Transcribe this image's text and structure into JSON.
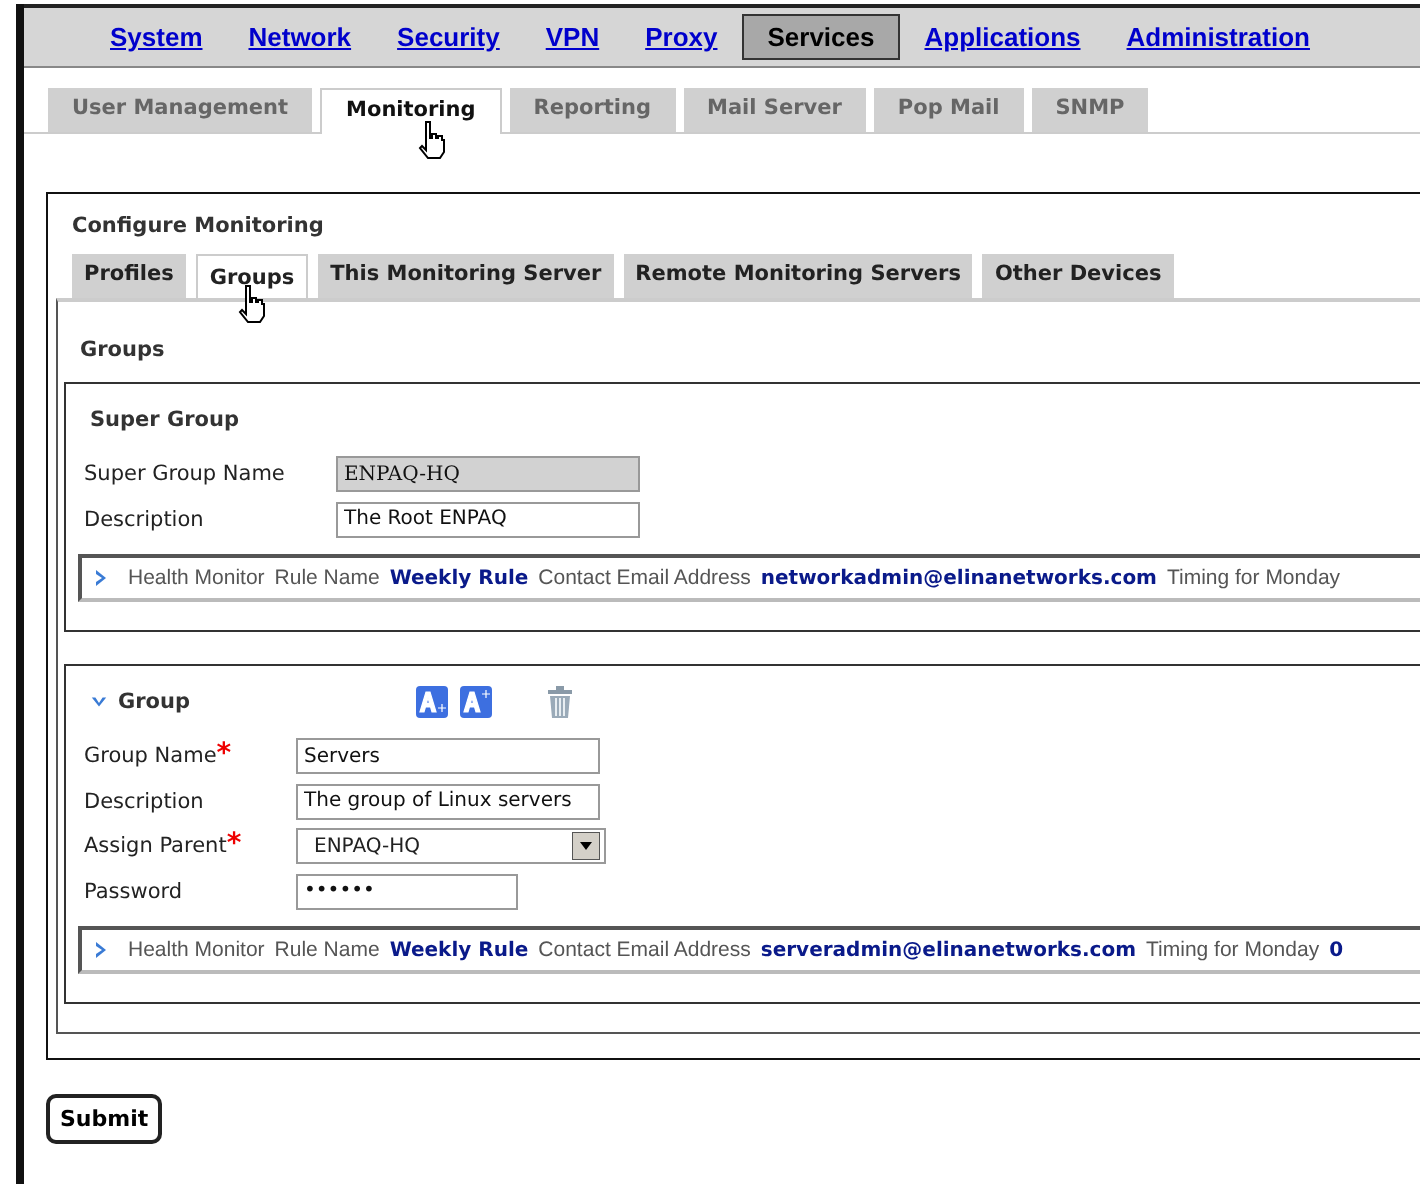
{
  "nav": [
    {
      "label": "System",
      "selected": false
    },
    {
      "label": "Network",
      "selected": false
    },
    {
      "label": "Security",
      "selected": false
    },
    {
      "label": "VPN",
      "selected": false
    },
    {
      "label": "Proxy",
      "selected": false
    },
    {
      "label": "Services",
      "selected": true
    },
    {
      "label": "Applications",
      "selected": false
    },
    {
      "label": "Administration",
      "selected": false
    }
  ],
  "subtabs": [
    {
      "label": "User Management",
      "selected": false
    },
    {
      "label": "Monitoring",
      "selected": true
    },
    {
      "label": "Reporting",
      "selected": false
    },
    {
      "label": "Mail Server",
      "selected": false
    },
    {
      "label": "Pop Mail",
      "selected": false
    },
    {
      "label": "SNMP",
      "selected": false
    }
  ],
  "section_title": "Configure Monitoring",
  "tabs": [
    {
      "label": "Profiles",
      "selected": false
    },
    {
      "label": "Groups",
      "selected": true
    },
    {
      "label": "This Monitoring Server",
      "selected": false
    },
    {
      "label": "Remote Monitoring Servers",
      "selected": false
    },
    {
      "label": "Other Devices",
      "selected": false
    }
  ],
  "panel_title": "Groups",
  "super_group": {
    "title": "Super Group",
    "fields": [
      {
        "label": "Super Group Name",
        "value": "ENPAQ-HQ",
        "kind": "readonly"
      },
      {
        "label": "Description",
        "value": "The Root ENPAQ",
        "kind": "text"
      }
    ],
    "monitor": {
      "expanded": false,
      "label": "Health Monitor",
      "rule_label": "Rule Name",
      "rule": "Weekly Rule",
      "email_label": "Contact Email Address",
      "email": "networkadmin@elinanetworks.com",
      "timing_label": "Timing for Monday"
    }
  },
  "group": {
    "title": "Group",
    "expanded": true,
    "fields": [
      {
        "label": "Group Name",
        "value": "Servers",
        "kind": "text",
        "required_mark": "*"
      },
      {
        "label": "Description",
        "value": "The group of Linux servers",
        "kind": "text"
      },
      {
        "label": "Assign Parent",
        "value": "ENPAQ-HQ",
        "kind": "select",
        "required_mark": "*"
      },
      {
        "label": "Password",
        "value": "••••••",
        "kind": "password"
      }
    ],
    "monitor": {
      "expanded": false,
      "label": "Health Monitor",
      "rule_label": "Rule Name",
      "rule": "Weekly Rule",
      "email_label": "Contact Email Address",
      "email": "serveradmin@elinanetworks.com",
      "timing_label": "Timing for Monday",
      "timing": "0"
    }
  },
  "submit": "Submit"
}
